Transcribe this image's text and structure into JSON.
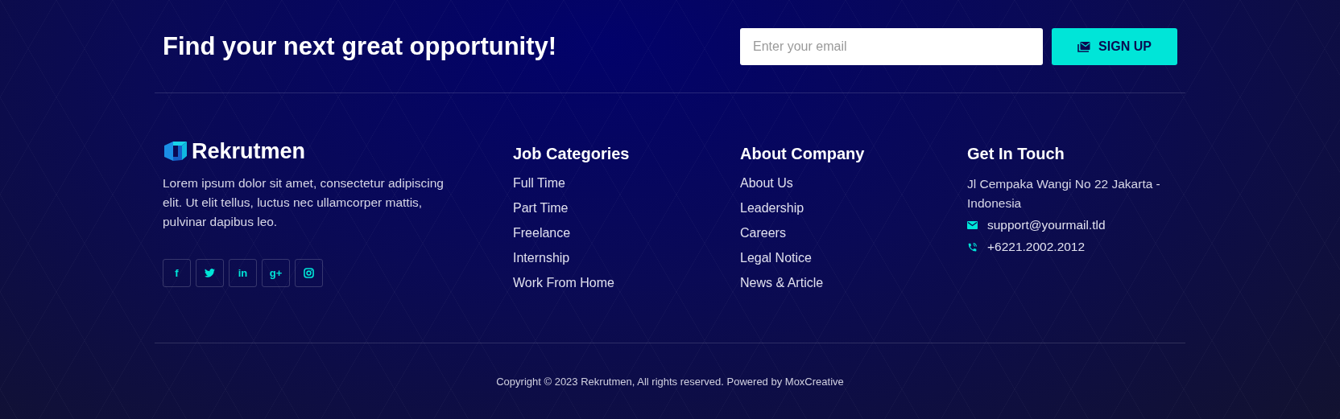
{
  "newsletter": {
    "heading": "Find your next great opportunity!",
    "email_placeholder": "Enter your email",
    "button": "SIGN UP"
  },
  "brand": {
    "name": "Rekrutmen",
    "description": "Lorem ipsum dolor sit amet, consectetur adipiscing elit. Ut elit tellus, luctus nec ullamcorper mattis, pulvinar dapibus leo.",
    "social": [
      {
        "kind": "glyph",
        "label": "f"
      },
      {
        "kind": "bird"
      },
      {
        "kind": "glyph",
        "label": "in"
      },
      {
        "kind": "glyph",
        "label": "g+"
      },
      {
        "kind": "camera"
      }
    ]
  },
  "columns": [
    {
      "title": "Job Categories",
      "links": [
        "Full Time",
        "Part Time",
        "Freelance",
        "Internship",
        "Work From Home"
      ]
    },
    {
      "title": "About Company",
      "links": [
        "About Us",
        "Leadership",
        "Careers",
        "Legal Notice",
        "News & Article"
      ]
    }
  ],
  "contact": {
    "title": "Get In Touch",
    "address": "Jl Cempaka Wangi No 22 Jakarta - Indonesia",
    "items": [
      {
        "kind": "email",
        "text": "support@yourmail.tld"
      },
      {
        "kind": "phone",
        "text": "+6221.2002.2012"
      }
    ]
  },
  "copyright": "Copyright © 2023 Rekrutmen, All rights reserved. Powered by MoxCreative"
}
